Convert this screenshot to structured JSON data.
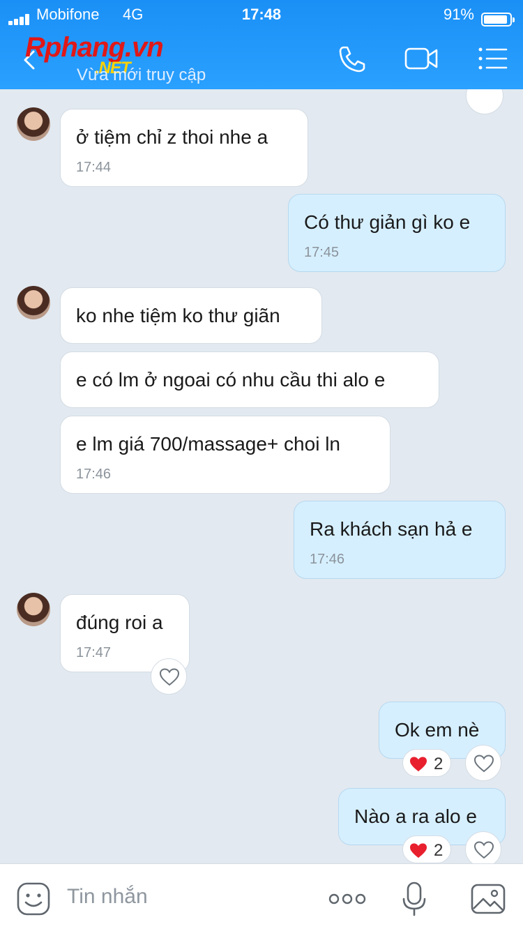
{
  "status_bar": {
    "carrier": "Mobifone",
    "network": "4G",
    "time": "17:48",
    "battery": "91%",
    "battery_level": 0.91
  },
  "header": {
    "logo_main": "Rphang.vn",
    "logo_sub": ".NET",
    "presence": "Vừa mới truy cập"
  },
  "messages": [
    {
      "side": "in",
      "text": "ở tiệm chỉ z thoi nhe a",
      "time": "17:44"
    },
    {
      "side": "out",
      "text": "Có thư giản gì ko e",
      "time": "17:45"
    },
    {
      "side": "in",
      "text": "ko nhe tiệm ko thư giãn"
    },
    {
      "side": "in",
      "text": "e có lm ở ngoai có nhu cầu thi alo e"
    },
    {
      "side": "in",
      "text": "e lm giá 700/massage+ choi ln",
      "time": "17:46"
    },
    {
      "side": "out",
      "text": "Ra khách sạn hả e",
      "time": "17:46"
    },
    {
      "side": "in",
      "text": "đúng roi a",
      "time": "17:47"
    },
    {
      "side": "out",
      "text": "Ok em nè",
      "reaction_count": "2"
    },
    {
      "side": "out",
      "text": "Nào a ra alo e",
      "reaction_count": "2"
    }
  ],
  "composer": {
    "placeholder": "Tin nhắn"
  },
  "colors": {
    "header": "#2196f3",
    "incoming_bubble": "#ffffff",
    "outgoing_bubble": "#d6efff",
    "background": "#e2e9f0",
    "heart": "#e8202e"
  },
  "icons": [
    "back-icon",
    "phone-icon",
    "video-call-icon",
    "menu-icon",
    "heart-outline-icon",
    "heart-filled-icon",
    "sticker-icon",
    "more-icon",
    "microphone-icon",
    "image-icon"
  ]
}
